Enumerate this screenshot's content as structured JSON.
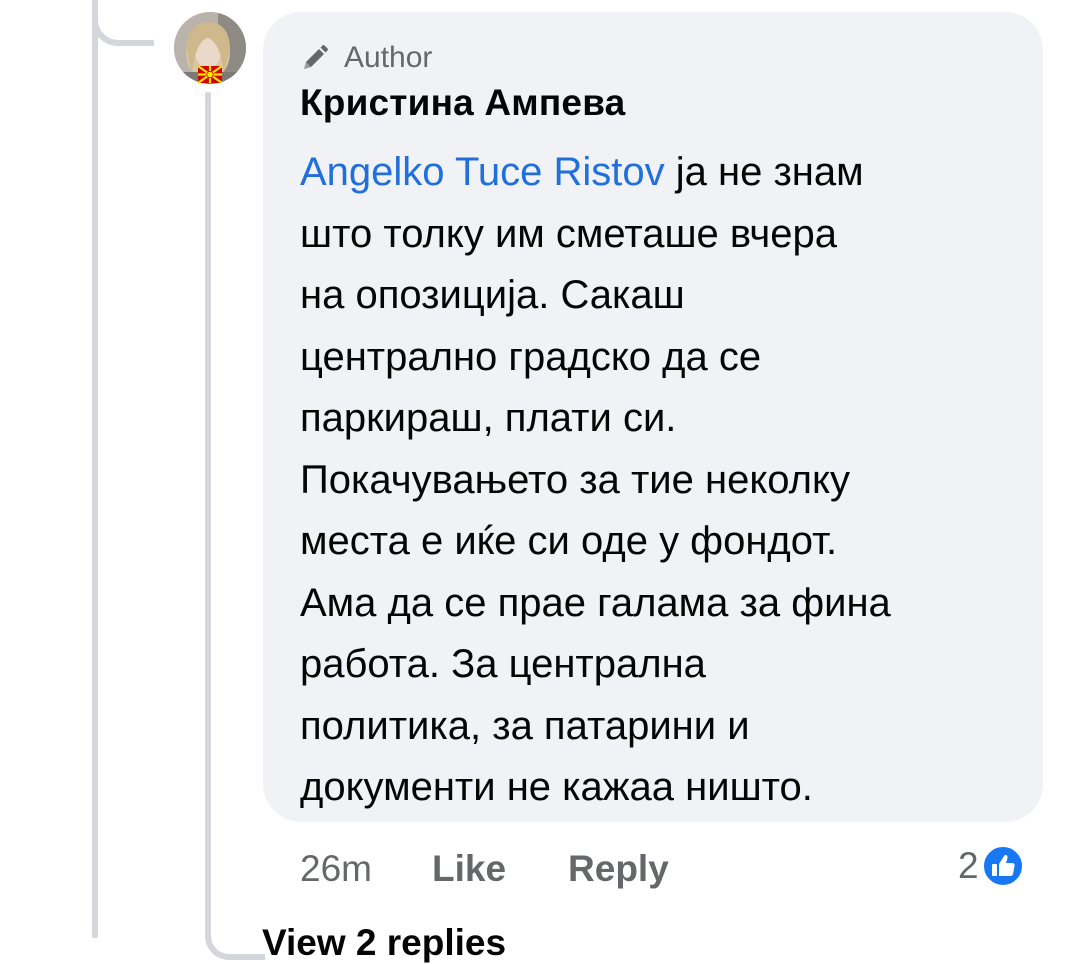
{
  "comment": {
    "author_badge": "Author",
    "author_badge_icon": "pencil-icon",
    "commenter_name": "Кристина Ампева",
    "mention": "Angelko Tuce Ristov",
    "body_lines": [
      " ја не знам",
      "што толку им сметаше вчера",
      "на опозиција. Сакаш",
      "централно градско да се",
      "паркираш, плати си.",
      "Покачувањето за тие неколку",
      "места е иќе си оде у фондот.",
      "Ама да се прае галама за фина",
      "работа. За централна",
      "политика, за патарини и",
      "документи не кажаа ништо."
    ],
    "time": "26m",
    "like_label": "Like",
    "reply_label": "Reply",
    "reaction_count": "2",
    "reaction_icon": "like-icon"
  },
  "view_replies_label": "View 2 replies",
  "colors": {
    "mention": "#216fdb",
    "bubble_bg": "#f0f2f5",
    "secondary_text": "#65676b",
    "like_badge": "#1877f2"
  }
}
